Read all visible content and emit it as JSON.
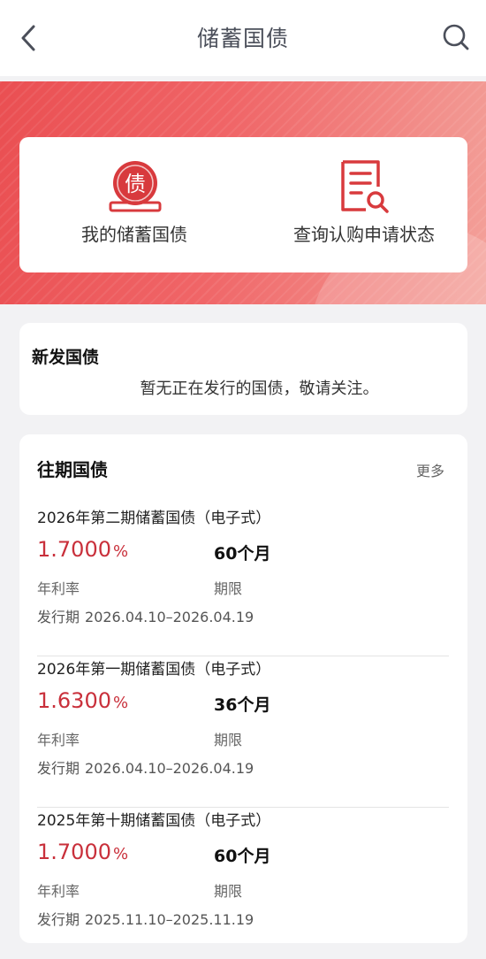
{
  "header": {
    "title": "储蓄国债",
    "back_icon": "chevron-left-icon",
    "search_icon": "search-icon"
  },
  "banner": {
    "colors": {
      "start": "#ea4f52",
      "end": "#f3a19a"
    }
  },
  "quick_actions": [
    {
      "label": "我的储蓄国债",
      "icon": "bond-badge-icon",
      "icon_char": "债"
    },
    {
      "label": "查询认购申请状态",
      "icon": "document-search-icon"
    }
  ],
  "new_issue": {
    "title": "新发国债",
    "message": "暂无正在发行的国债，敬请关注。"
  },
  "past_issues": {
    "title": "往期国债",
    "more_label": "更多",
    "rate_label": "年利率",
    "term_label": "期限",
    "period_label": "发行期",
    "items": [
      {
        "name": "2026年第二期储蓄国债（电子式）",
        "rate": "1.7000",
        "rate_unit": "%",
        "term": "60个月",
        "period": "2026.04.10–2026.04.19"
      },
      {
        "name": "2026年第一期储蓄国债（电子式）",
        "rate": "1.6300",
        "rate_unit": "%",
        "term": "36个月",
        "period": "2026.04.10–2026.04.19"
      },
      {
        "name": "2025年第十期储蓄国债（电子式）",
        "rate": "1.7000",
        "rate_unit": "%",
        "term": "60个月",
        "period": "2025.11.10–2025.11.19"
      }
    ]
  },
  "colors": {
    "accent_red": "#c9303b",
    "icon_red": "#d83a3d"
  }
}
